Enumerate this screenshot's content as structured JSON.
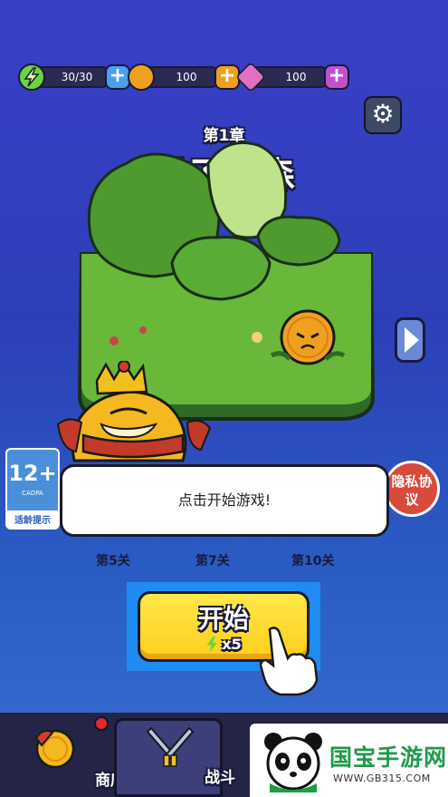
{
  "resources": {
    "energy": {
      "value": "30/30",
      "plus": "+",
      "color": "#6cd440"
    },
    "coins": {
      "value": "100",
      "plus": "+",
      "color": "#f0a020"
    },
    "gems": {
      "value": "100",
      "plus": "+",
      "color": "#e070c0"
    }
  },
  "chapter": {
    "number": "第1章",
    "name": "橘子之森"
  },
  "age_rating": {
    "rating": "12+",
    "org": "CADPA",
    "tip": "适龄提示"
  },
  "privacy": {
    "label": "隐私协议"
  },
  "dialog": {
    "text": "点击开始游戏!"
  },
  "levels": [
    "第5关",
    "第7关",
    "第10关"
  ],
  "start_button": {
    "label": "开始",
    "cost": "x5"
  },
  "tabs": [
    {
      "label": "商店",
      "icon": "shop-icon"
    },
    {
      "label": "战斗",
      "icon": "crossed-swords-icon"
    }
  ],
  "watermark": {
    "brand": "国宝手游网",
    "url": "WWW.GB315.COM"
  }
}
